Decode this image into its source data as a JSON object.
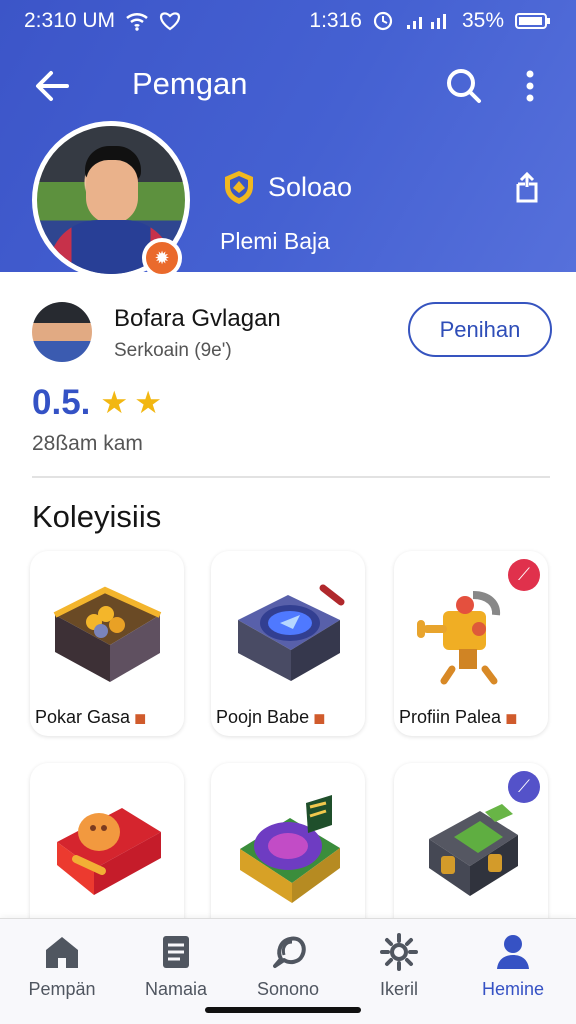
{
  "status_bar": {
    "time": "2:310 UM",
    "right_text": "1:316",
    "battery": "35%",
    "icons": [
      "wifi-icon",
      "heart-icon",
      "clock-icon",
      "signal-icon",
      "battery-icon"
    ]
  },
  "app_bar": {
    "title": "Pemgan",
    "icons": [
      "back-arrow-icon",
      "search-icon",
      "more-vert-icon"
    ]
  },
  "profile": {
    "verified_name": "Soloao",
    "subtitle": "Plemi Baja",
    "badge_icon": "star-badge-icon",
    "share_icon": "share-icon"
  },
  "seller": {
    "name": "Bofara Gvlagan",
    "meta": "Serkoain (9e')",
    "follow_label": "Penihan"
  },
  "rating": {
    "value": "0.5.",
    "stars": 2,
    "reviews": "28ßam kam"
  },
  "collection": {
    "title": "Koleyisiis",
    "items": [
      {
        "label": "Pokar Gasa",
        "icon": "chest-coins-icon",
        "badge": "",
        "badge_color": ""
      },
      {
        "label": "Poojn Babe",
        "icon": "tech-vault-icon",
        "badge": "",
        "badge_color": ""
      },
      {
        "label": "Profiin Palea",
        "icon": "robot-key-icon",
        "badge": "pin-icon",
        "badge_color": "#e0314c"
      },
      {
        "label": "",
        "icon": "treasure-box-icon",
        "badge": "",
        "badge_color": ""
      },
      {
        "label": "",
        "icon": "portal-box-icon",
        "badge": "",
        "badge_color": ""
      },
      {
        "label": "",
        "icon": "green-chest-icon",
        "badge": "pin-icon",
        "badge_color": "#5452c9"
      }
    ]
  },
  "bottom_nav": [
    {
      "label": "Pempän",
      "icon": "home-icon",
      "active": false
    },
    {
      "label": "Namaia",
      "icon": "document-icon",
      "active": false
    },
    {
      "label": "Sonono",
      "icon": "chat-search-icon",
      "active": false
    },
    {
      "label": "Ikeril",
      "icon": "settings-icon",
      "active": false
    },
    {
      "label": "Hemine",
      "icon": "profile-icon",
      "active": true
    }
  ],
  "colors": {
    "primary": "#3c55c8",
    "accent": "#f2b712",
    "orange": "#ea6a2c"
  }
}
